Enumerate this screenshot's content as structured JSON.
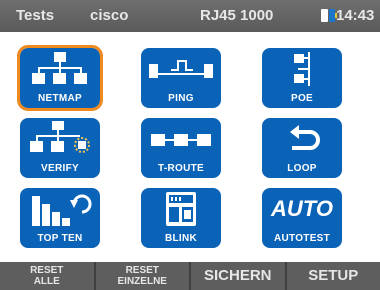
{
  "statusbar": {
    "title": "Tests",
    "user": "cisco",
    "link": "RJ45 1000",
    "battery_icon": "battery-icon",
    "time": "14:43"
  },
  "tiles": [
    {
      "label": "NETMAP",
      "icon": "network-map-icon",
      "selected": true
    },
    {
      "label": "PING",
      "icon": "ping-pulse-icon"
    },
    {
      "label": "POE",
      "icon": "poe-icon"
    },
    {
      "label": "VERIFY",
      "icon": "verify-network-icon"
    },
    {
      "label": "T-ROUTE",
      "icon": "trace-route-icon"
    },
    {
      "label": "LOOP",
      "icon": "loop-arrow-icon"
    },
    {
      "label": "TOP TEN",
      "icon": "bar-chart-icon"
    },
    {
      "label": "BLINK",
      "icon": "blink-port-icon"
    },
    {
      "label": "AUTOTEST",
      "icon_text": "AUTO"
    }
  ],
  "softkeys": {
    "reset_all_line1": "RESET",
    "reset_all_line2": "ALLE",
    "reset_single_line1": "RESET",
    "reset_single_line2": "EINZELNE",
    "save": "SICHERN",
    "setup": "SETUP"
  },
  "colors": {
    "tile_blue": "#0b63b8",
    "selection_orange": "#ef8a1f",
    "bar_gray": "#5e5e5e"
  }
}
